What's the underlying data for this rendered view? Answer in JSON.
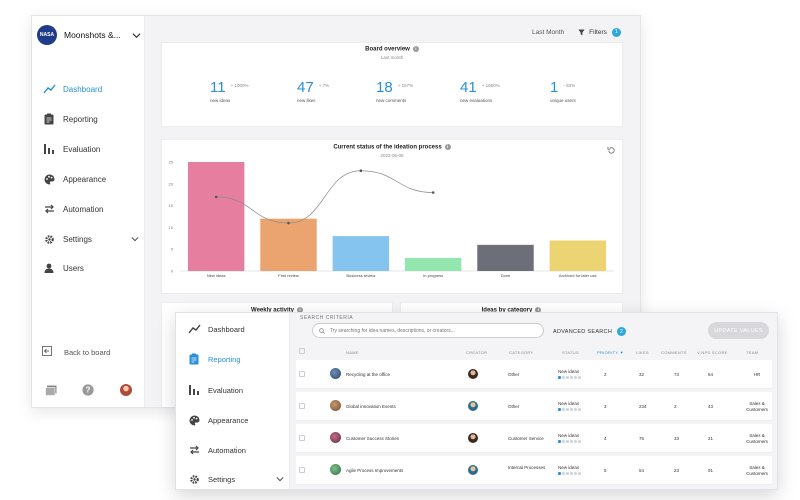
{
  "back_window": {
    "org": {
      "logo_text": "NASA",
      "name": "Moonshots &..."
    },
    "nav": [
      {
        "label": "Dashboard",
        "icon": "trend-line-icon",
        "active": true
      },
      {
        "label": "Reporting",
        "icon": "clipboard-icon",
        "active": false
      },
      {
        "label": "Evaluation",
        "icon": "bar-stats-icon",
        "active": false
      },
      {
        "label": "Appearance",
        "icon": "palette-icon",
        "active": false
      },
      {
        "label": "Automation",
        "icon": "swap-arrows-icon",
        "active": false
      },
      {
        "label": "Settings",
        "icon": "gear-icon",
        "active": false
      },
      {
        "label": "Users",
        "icon": "user-icon",
        "active": false
      }
    ],
    "back_label": "Back to board",
    "topbar": {
      "period": "Last Month",
      "filters_label": "Filters",
      "filters_count": "1"
    },
    "board_overview": {
      "title": "Board overview",
      "subtitle": "Last month",
      "stats": [
        {
          "value": "11",
          "change": "+ 1000%",
          "label": "new ideas"
        },
        {
          "value": "47",
          "change": "+ 7%",
          "label": "new likes"
        },
        {
          "value": "18",
          "change": "+ 157%",
          "label": "new comments"
        },
        {
          "value": "41",
          "change": "+ 1950%",
          "label": "new evaluations"
        },
        {
          "value": "1",
          "change": "- 83%",
          "label": "unique users"
        }
      ]
    },
    "weekly_activity": {
      "title": "Weekly activity"
    },
    "ideas_by_category": {
      "title": "Ideas by category"
    }
  },
  "chart_data": {
    "type": "bar",
    "title": "Current status of the ideation process",
    "subtitle": "2022-05-06",
    "categories": [
      "New ideas",
      "First review",
      "Business review",
      "In progress",
      "Done",
      "Archived for later use"
    ],
    "values": [
      25,
      12,
      8,
      3,
      6,
      7
    ],
    "colors": [
      "#e67ea0",
      "#eba46f",
      "#84c4ef",
      "#93e6ae",
      "#6d6f78",
      "#ecd473"
    ],
    "line_series": [
      17,
      11,
      23,
      18
    ],
    "ylim": [
      0,
      25
    ],
    "yticks": [
      0,
      5,
      10,
      15,
      20,
      25
    ],
    "xlabel": "",
    "ylabel": "",
    "legend": "none"
  },
  "front_window": {
    "nav": [
      {
        "label": "Dashboard",
        "icon": "trend-line-icon",
        "active": false
      },
      {
        "label": "Reporting",
        "icon": "clipboard-icon",
        "active": true
      },
      {
        "label": "Evaluation",
        "icon": "bar-stats-icon",
        "active": false
      },
      {
        "label": "Appearance",
        "icon": "palette-icon",
        "active": false
      },
      {
        "label": "Automation",
        "icon": "swap-arrows-icon",
        "active": false
      },
      {
        "label": "Settings",
        "icon": "gear-icon",
        "active": false
      }
    ],
    "search_criteria_label": "SEARCH CRITERIA",
    "search_placeholder": "Try searching for idea names, descriptions, or creators...",
    "advanced_search_label": "ADVANCED SEARCH",
    "advanced_search_count": "2",
    "update_values_label": "UPDATE VALUES",
    "columns": [
      "NAME",
      "CREATOR",
      "CATEGORY",
      "STATUS",
      "PRIORITY ▼",
      "LIKES",
      "COMMENTS",
      "V-NPS SCORE",
      "TEAM"
    ],
    "rows": [
      {
        "name": "Recycling at the office",
        "category": "Other",
        "status": "New ideas",
        "priority": "2",
        "likes": "32",
        "comments": "73",
        "vnps": "64",
        "team": "HR"
      },
      {
        "name": "Global innovation Events",
        "category": "Other",
        "status": "New ideas",
        "priority": "3",
        "likes": "234",
        "comments": "2",
        "vnps": "43",
        "team": "Sales & Customers"
      },
      {
        "name": "Customer Success Stories",
        "category": "Customer Service",
        "status": "New ideas",
        "priority": "4",
        "likes": "76",
        "comments": "33",
        "vnps": "21",
        "team": "Sales & Customers"
      },
      {
        "name": "Agile Process Improvements",
        "category": "Internal Processes",
        "status": "New ideas",
        "priority": "5",
        "likes": "54",
        "comments": "23",
        "vnps": "91",
        "team": "Sales & Customers"
      }
    ]
  },
  "colors": {
    "accent": "#2a8fd6",
    "badge": "#2aa7de"
  }
}
